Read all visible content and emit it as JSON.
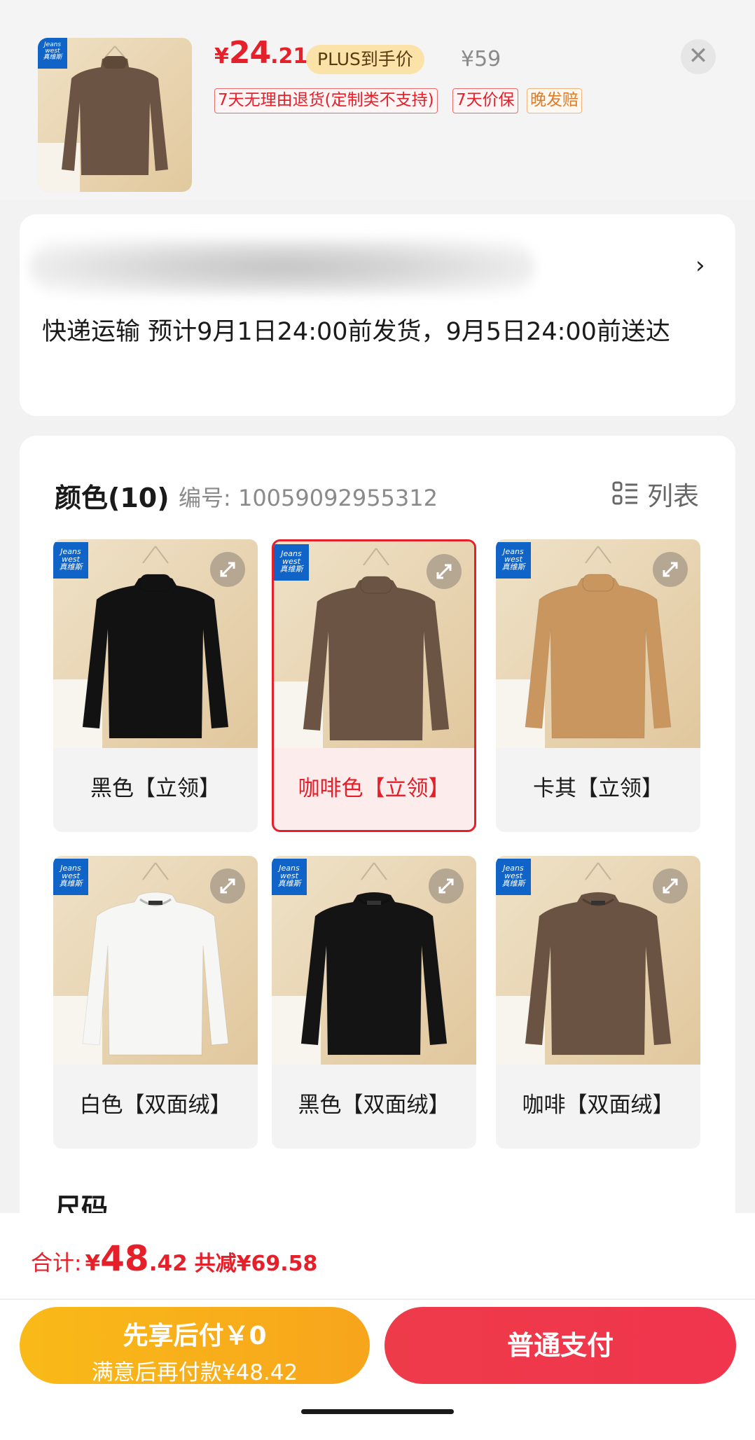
{
  "header": {
    "price_symbol": "¥",
    "price_int": "24",
    "price_dec": ".21",
    "plus_tag": "PLUS到手价",
    "original_price": "¥59",
    "tags": [
      "7天无理由退货(定制类不支持)",
      "7天价保",
      "晚发赔"
    ],
    "close_icon": "close-icon"
  },
  "shipping": {
    "text": "快递运输 预计9月1日24:00前发货，9月5日24:00前送达",
    "arrow_icon": "chevron-right-icon"
  },
  "color_section": {
    "title": "颜色(10)",
    "code": "编号: 10059092955312",
    "view_toggle": "列表",
    "options": [
      {
        "label": "黑色【立领】",
        "selected": false,
        "shirt_color": "#121212",
        "collar": "turtleneck"
      },
      {
        "label": "咖啡色【立领】",
        "selected": true,
        "shirt_color": "#6b5443",
        "collar": "turtleneck"
      },
      {
        "label": "卡其【立领】",
        "selected": false,
        "shirt_color": "#c9965f",
        "collar": "turtleneck"
      },
      {
        "label": "白色【双面绒】",
        "selected": false,
        "shirt_color": "#f6f6f4",
        "collar": "crew"
      },
      {
        "label": "黑色【双面绒】",
        "selected": false,
        "shirt_color": "#141414",
        "collar": "crew"
      },
      {
        "label": "咖啡【双面绒】",
        "selected": false,
        "shirt_color": "#6a5342",
        "collar": "crew"
      }
    ]
  },
  "size_section": {
    "title": "尺码"
  },
  "footer": {
    "total_label": "合计:",
    "total_symbol": "¥",
    "total_int": "48",
    "total_dec": ".42",
    "saving": "共减¥69.58",
    "pay_later_line1": "先享后付￥0",
    "pay_later_line2": "满意后再付款¥48.42",
    "pay_normal": "普通支付"
  },
  "colors": {
    "accent": "#e5202a",
    "pay_later": "#f9ba18",
    "pay_normal": "#ee3b4a",
    "brand_blue": "#1063c7"
  },
  "brand_logo_text": "Jeans west 真维斯"
}
